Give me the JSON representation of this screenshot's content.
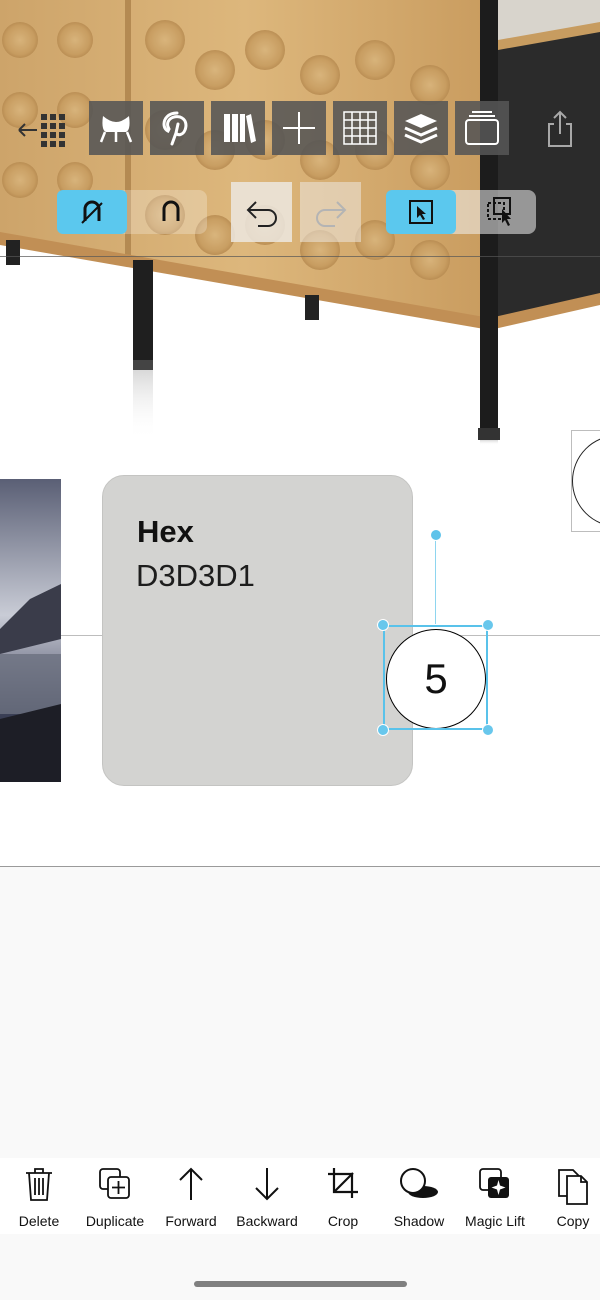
{
  "canvas": {
    "hex_card": {
      "title": "Hex",
      "value": "D3D3D1",
      "color": "#D3D3D1"
    },
    "selected_item": {
      "number": "5"
    }
  },
  "top_toolbar": {
    "items": [
      {
        "name": "grid-back",
        "icon": "grid-back-icon"
      },
      {
        "name": "furniture",
        "icon": "chair-icon"
      },
      {
        "name": "pinterest",
        "icon": "pinterest-icon"
      },
      {
        "name": "library",
        "icon": "books-icon"
      },
      {
        "name": "add",
        "icon": "plus-icon"
      },
      {
        "name": "grid",
        "icon": "grid-icon"
      },
      {
        "name": "layers",
        "icon": "layers-icon"
      },
      {
        "name": "pages",
        "icon": "pages-icon"
      },
      {
        "name": "share",
        "icon": "share-icon"
      }
    ]
  },
  "sub_toolbar": {
    "accent": "#5bc8ee",
    "items": [
      {
        "name": "magnet-off",
        "icon": "magnet-off-icon",
        "active": true
      },
      {
        "name": "magnet",
        "icon": "magnet-icon",
        "active": false
      },
      {
        "name": "undo",
        "icon": "undo-icon",
        "active": false
      },
      {
        "name": "redo",
        "icon": "redo-icon",
        "active": false
      },
      {
        "name": "select",
        "icon": "cursor-select-icon",
        "active": true
      },
      {
        "name": "multi-select",
        "icon": "multi-select-icon",
        "active": false
      }
    ]
  },
  "bottom_toolbar": {
    "items": [
      {
        "label": "Delete",
        "icon": "trash-icon"
      },
      {
        "label": "Duplicate",
        "icon": "duplicate-icon"
      },
      {
        "label": "Forward",
        "icon": "arrow-up-icon"
      },
      {
        "label": "Backward",
        "icon": "arrow-down-icon"
      },
      {
        "label": "Crop",
        "icon": "crop-icon"
      },
      {
        "label": "Shadow",
        "icon": "shadow-icon"
      },
      {
        "label": "Magic Lift",
        "icon": "magic-lift-icon"
      },
      {
        "label": "Copy",
        "icon": "copy-icon"
      }
    ]
  }
}
